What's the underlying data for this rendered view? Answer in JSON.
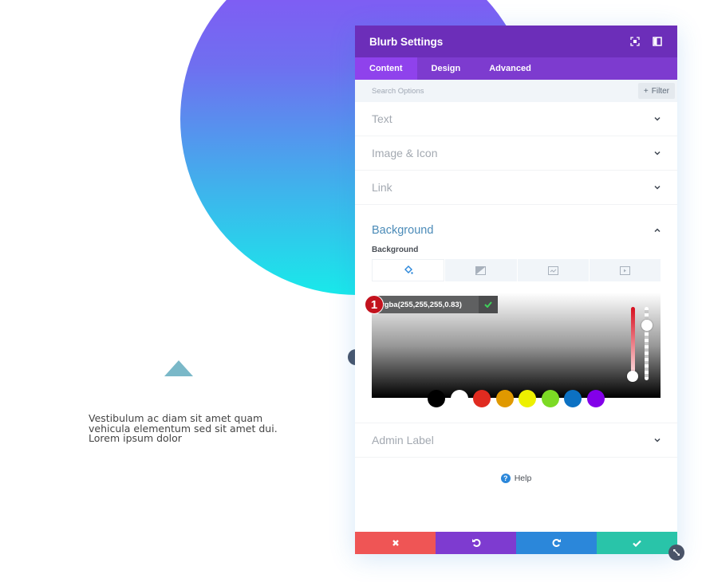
{
  "colors": {
    "header_bg": "#6c2eb9",
    "tabs_bg": "#7d3bcf",
    "active_tab_bg": "#8f42ec",
    "section_open_color": "#4b8bb8",
    "cancel": "#ef5555",
    "undo": "#7e3bd0",
    "redo": "#2b87da",
    "save": "#29c4a9",
    "badge": "#c3121d"
  },
  "page": {
    "body_text": "Vestibulum ac diam sit amet quam vehicula elementum sed sit amet dui. Lorem ipsum dolor",
    "icon": "triangle-up-icon"
  },
  "panel": {
    "title": "Blurb Settings",
    "header_icons": [
      "focus-icon",
      "sidebar-toggle-icon"
    ],
    "tabs": [
      {
        "label": "Content",
        "active": true
      },
      {
        "label": "Design",
        "active": false
      },
      {
        "label": "Advanced",
        "active": false
      }
    ],
    "search": {
      "placeholder": "Search Options",
      "value": ""
    },
    "filter_label": "Filter",
    "sections": [
      {
        "label": "Text",
        "open": false
      },
      {
        "label": "Image & Icon",
        "open": false
      },
      {
        "label": "Link",
        "open": false
      },
      {
        "label": "Background",
        "open": true
      },
      {
        "label": "Admin Label",
        "open": false
      }
    ],
    "background": {
      "title": "Background",
      "field_label": "Background",
      "type_tabs": [
        {
          "name": "color",
          "icon": "paint-bucket-icon",
          "active": true
        },
        {
          "name": "gradient",
          "icon": "gradient-icon",
          "active": false
        },
        {
          "name": "image",
          "icon": "image-icon",
          "active": false
        },
        {
          "name": "video",
          "icon": "video-icon",
          "active": false
        }
      ],
      "color_value": "rgba(255,255,255,0.83)",
      "alpha": 0.83,
      "badge_number": "1",
      "swatches": [
        "#000000",
        "#ffffff",
        "#e02b20",
        "#e09900",
        "#edf000",
        "#7cda24",
        "#0c71c3",
        "#8300e9"
      ]
    },
    "help_label": "Help",
    "footer": [
      {
        "name": "cancel",
        "icon": "close-icon"
      },
      {
        "name": "undo",
        "icon": "undo-icon"
      },
      {
        "name": "redo",
        "icon": "redo-icon"
      },
      {
        "name": "save",
        "icon": "check-icon"
      }
    ]
  }
}
